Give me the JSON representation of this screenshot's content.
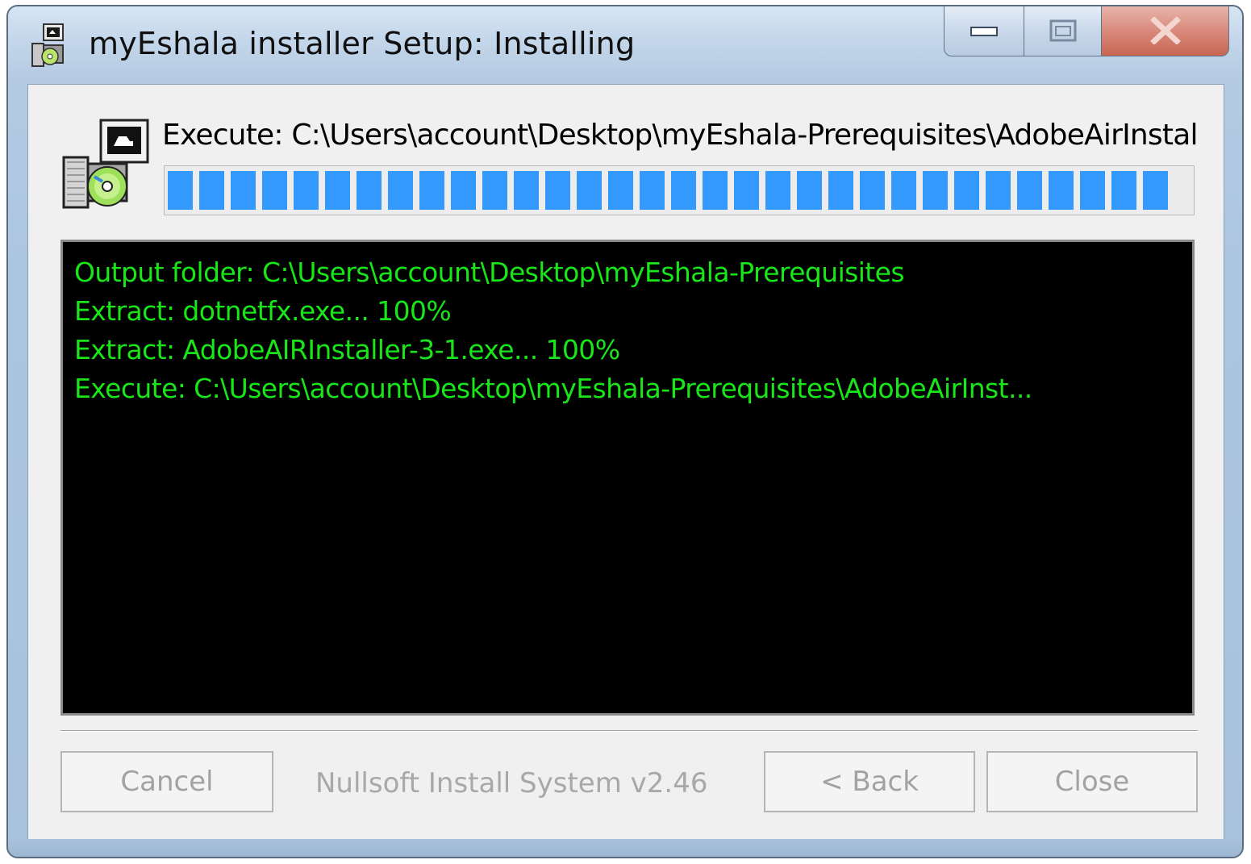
{
  "window": {
    "title": "myEshala installer Setup: Installing"
  },
  "caption_buttons": {
    "minimize": "minimize-icon",
    "maximize": "maximize-icon",
    "close": "close-icon"
  },
  "header": {
    "status": "Execute: C:\\Users\\account\\Desktop\\myEshala-Prerequisites\\AdobeAirInstal",
    "icon": "installer-cd-icon"
  },
  "progress": {
    "percent": 98,
    "color": "#3399ff"
  },
  "log": {
    "text_color": "#19e619",
    "lines": [
      "Output folder: C:\\Users\\account\\Desktop\\myEshala-Prerequisites",
      "Extract: dotnetfx.exe... 100%",
      "Extract: AdobeAIRInstaller-3-1.exe... 100%",
      "Execute: C:\\Users\\account\\Desktop\\myEshala-Prerequisites\\AdobeAirInst..."
    ]
  },
  "footer": {
    "cancel_label": "Cancel",
    "branding": "Nullsoft Install System v2.46",
    "back_label": "< Back",
    "close_label": "Close"
  }
}
